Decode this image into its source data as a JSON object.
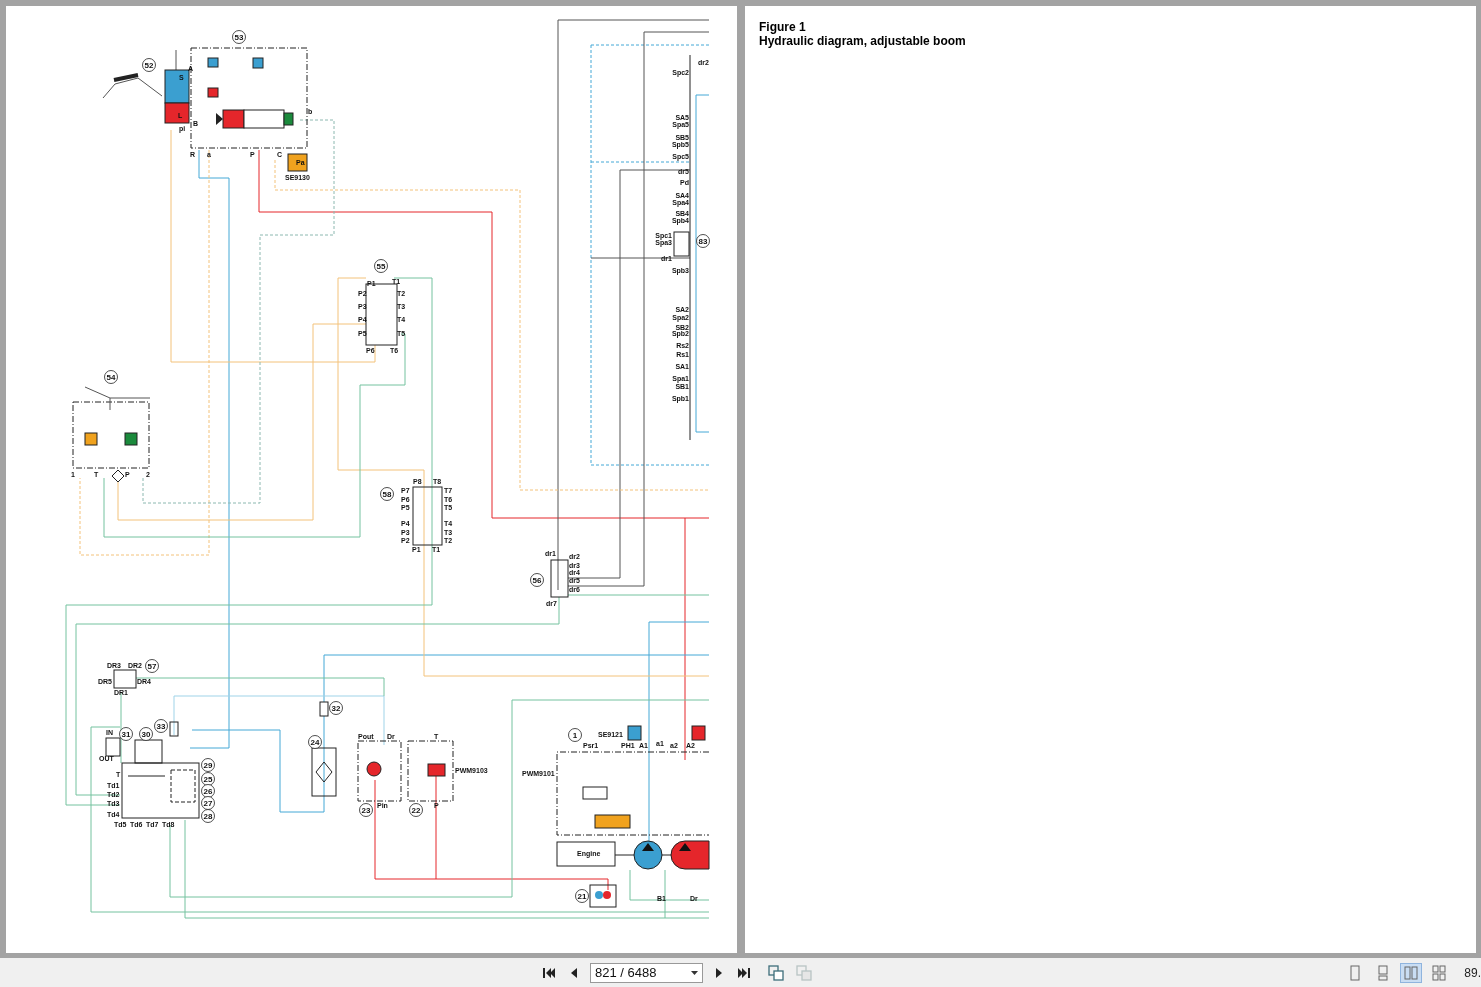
{
  "left_page": {
    "callouts": [
      "52",
      "53",
      "55",
      "54",
      "58",
      "56",
      "57",
      "83",
      "33",
      "31",
      "30",
      "29",
      "25",
      "26",
      "27",
      "28",
      "32",
      "24",
      "23",
      "22",
      "1",
      "21"
    ],
    "labels": [
      "A",
      "S",
      "L",
      "B",
      "pi",
      "b",
      "R",
      "a",
      "P",
      "C",
      "Pa",
      "SE9130",
      "dr2",
      "Spc2",
      "SA5",
      "Spa5",
      "SB5",
      "Spb5",
      "Spc5",
      "dr5",
      "Pd",
      "SA4",
      "Spa4",
      "SB4",
      "Spb4",
      "Spc1",
      "Spa3",
      "dr1",
      "Spb3",
      "SA2",
      "Spa2",
      "SB2",
      "Spb2",
      "Rs2",
      "Rs1",
      "SA1",
      "Spa1",
      "SB1",
      "Spb1",
      "P1",
      "T1",
      "P2",
      "T2",
      "P3",
      "T3",
      "P4",
      "T4",
      "P5",
      "T5",
      "P6",
      "T6",
      "1",
      "T",
      "P",
      "2",
      "P8",
      "T8",
      "P7",
      "T7",
      "P6",
      "T6",
      "P5",
      "T5",
      "P4",
      "T4",
      "P3",
      "T3",
      "P2",
      "T2",
      "P1",
      "T1",
      "dr1",
      "dr2",
      "dr3",
      "dr4",
      "dr5",
      "dr6",
      "dr7",
      "DR3",
      "DR2",
      "DR5",
      "DR4",
      "DR1",
      "IN",
      "OUT",
      "T",
      "Td1",
      "Td2",
      "Td3",
      "Td4",
      "Td5",
      "Td6",
      "Td7",
      "Td8",
      "Pout",
      "Dr",
      "T",
      "Pin",
      "P",
      "PWM9103",
      "SE9121",
      "Psr1",
      "PH1",
      "A1",
      "a1",
      "a2",
      "A2",
      "PWM9101",
      "Engine",
      "B1",
      "Dr"
    ]
  },
  "right_page": {
    "figure_number": "Figure 1",
    "caption": "Hydraulic diagram, adjustable boom"
  },
  "toolbar": {
    "page_field": "821 / 6488",
    "tools": [
      {
        "disabled": false
      },
      {
        "disabled": true
      }
    ],
    "view_modes": [
      {
        "selected": false
      },
      {
        "selected": false
      },
      {
        "selected": true
      },
      {
        "selected": false
      }
    ],
    "zoom": "89."
  }
}
